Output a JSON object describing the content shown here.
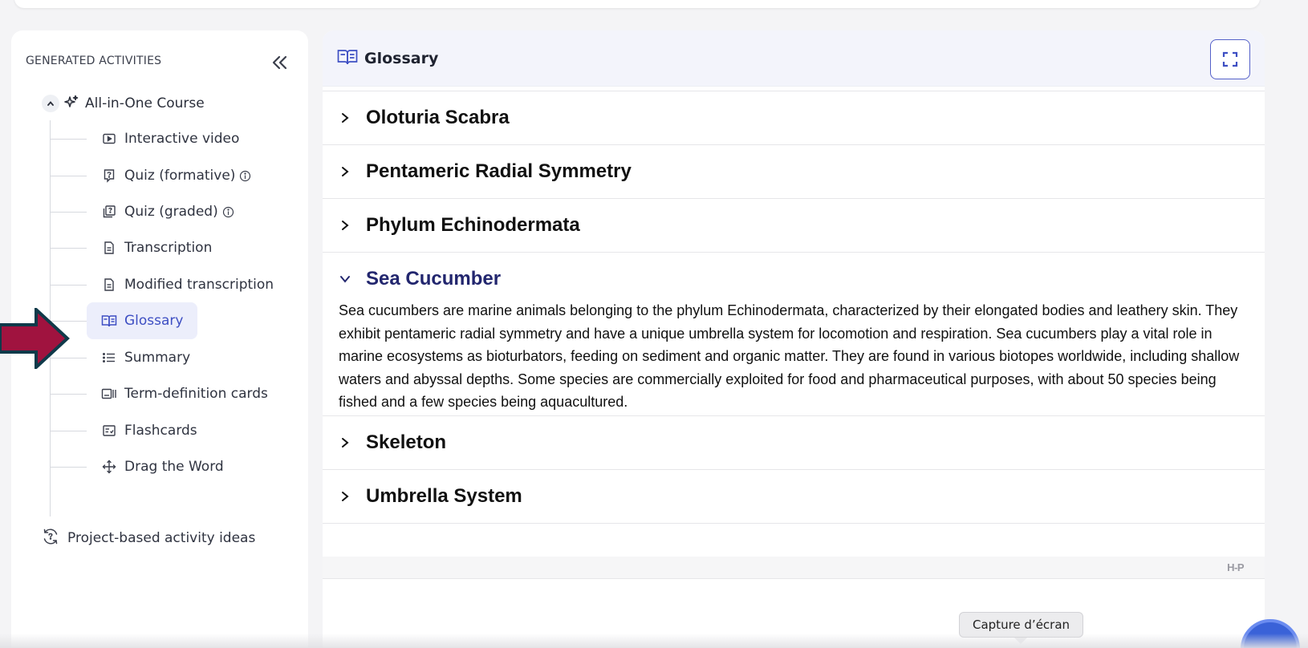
{
  "sidebar": {
    "title": "GENERATED ACTIVITIES",
    "root": {
      "label": "All-in-One Course"
    },
    "items": [
      {
        "label": "Interactive video",
        "icon": "play-box-icon",
        "info": false,
        "active": false
      },
      {
        "label": "Quiz (formative)",
        "icon": "quiz-formative-icon",
        "info": true,
        "active": false
      },
      {
        "label": "Quiz (graded)",
        "icon": "quiz-graded-icon",
        "info": true,
        "active": false
      },
      {
        "label": "Transcription",
        "icon": "document-icon",
        "info": false,
        "active": false
      },
      {
        "label": "Modified transcription",
        "icon": "document-icon",
        "info": false,
        "active": false
      },
      {
        "label": "Glossary",
        "icon": "book-open-icon",
        "info": false,
        "active": true
      },
      {
        "label": "Summary",
        "icon": "list-icon",
        "info": false,
        "active": false
      },
      {
        "label": "Term-definition cards",
        "icon": "cards-icon",
        "info": false,
        "active": false
      },
      {
        "label": "Flashcards",
        "icon": "flashcard-icon",
        "info": false,
        "active": false
      },
      {
        "label": "Drag the Word",
        "icon": "move-icon",
        "info": false,
        "active": false
      }
    ],
    "project": {
      "label": "Project-based activity ideas"
    }
  },
  "main": {
    "title": "Glossary",
    "terms": [
      {
        "term": "Oloturia Scabra",
        "open": false
      },
      {
        "term": "Pentameric Radial Symmetry",
        "open": false
      },
      {
        "term": "Phylum Echinodermata",
        "open": false
      },
      {
        "term": "Sea Cucumber",
        "open": true,
        "definition": "Sea cucumbers are marine animals belonging to the phylum Echinodermata, characterized by their elongated bodies and leathery skin. They exhibit pentameric radial symmetry and have a unique umbrella system for locomotion and respiration. Sea cucumbers play a vital role in marine ecosystems as bioturbators, feeding on sediment and organic matter. They are found in various biotopes worldwide, including shallow waters and abyssal depths. Some species are commercially exploited for food and pharmaceutical purposes, with about 50 species being fished and a few species being aquacultured."
      },
      {
        "term": "Skeleton",
        "open": false
      },
      {
        "term": "Umbrella System",
        "open": false
      }
    ],
    "h5p_logo": "H-P"
  },
  "tooltip": {
    "text": "Capture d’écran"
  },
  "colors": {
    "accent": "#3e4fc3",
    "active_bg": "#eceefb",
    "arrow_fill": "#a0133f",
    "arrow_stroke": "#0f3a4a",
    "open_term": "#22266e"
  }
}
